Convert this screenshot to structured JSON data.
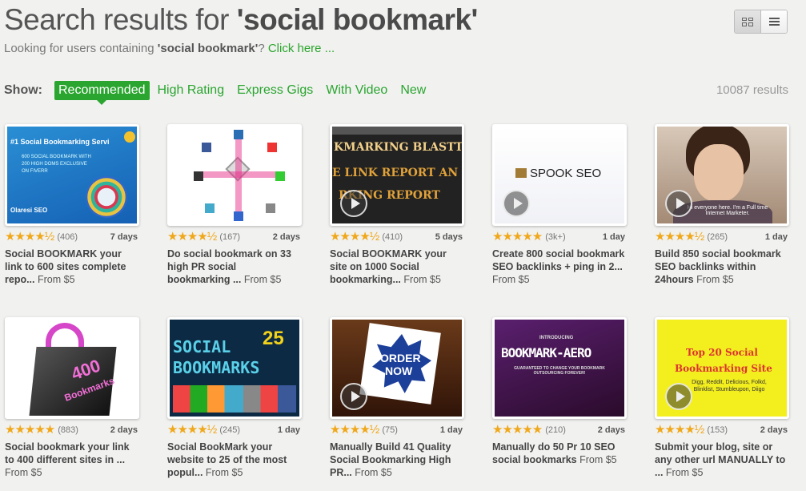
{
  "header": {
    "title_prefix": "Search results for ",
    "query": "'social bookmark'",
    "sub_prefix": "Looking for users containing ",
    "sub_query": "'social bookmark'",
    "sub_suffix": "? ",
    "sub_link": "Click here ..."
  },
  "view_toggle": {
    "grid_icon": "grid-icon",
    "list_icon": "list-icon"
  },
  "filters": {
    "show_label": "Show:",
    "active": "Recommended",
    "links": [
      "High Rating",
      "Express Gigs",
      "With Video",
      "New"
    ]
  },
  "results_count": "10087 results",
  "colors": {
    "accent": "#2aa52f",
    "stars": "#f0a81a"
  },
  "gigs": [
    {
      "stars": "★★★★½",
      "reviews": "(406)",
      "days": "7 days",
      "title": "Social BOOKMARK your link to 600 sites complete repo...",
      "price": "From $5",
      "video": false,
      "art": {
        "line1": "#1 Social Bookmarking Servi",
        "line2": "600 SOCIAL BOOKMARK WITH 200 HIGH DOMS EXCLUSIVE ON FIVERR",
        "brand": "Olaresi SEO"
      }
    },
    {
      "stars": "★★★★½",
      "reviews": "(167)",
      "days": "2 days",
      "title": "Do social bookmark on 33 high PR social bookmarking ...",
      "price": "From $5",
      "video": false,
      "art": {}
    },
    {
      "stars": "★★★★½",
      "reviews": "(410)",
      "days": "5 days",
      "title": "Social BOOKMARK your site on 1000 Social bookmarking...",
      "price": "From $5",
      "video": true,
      "art": {
        "line1": "KMARKING BLASTTI",
        "line2": "E LINK REPORT AN",
        "line3": "RKING REPORT"
      }
    },
    {
      "stars": "★★★★★",
      "reviews": "(3k+)",
      "days": "1 day",
      "title": "Create 800 social bookmark SEO backlinks + ping in 2...",
      "price": "From $5",
      "video": true,
      "art": {
        "line1": "SPOOK SEO"
      }
    },
    {
      "stars": "★★★★½",
      "reviews": "(265)",
      "days": "1 day",
      "title": "Build 850 social bookmark SEO backlinks within 24hours",
      "price": "From $5",
      "video": true,
      "art": {
        "line1": "Hi everyone here. I'm a Full time Internet Marketer."
      }
    },
    {
      "stars": "★★★★★",
      "reviews": "(883)",
      "days": "2 days",
      "title": "Social bookmark your link to 400 different sites in ...",
      "price": "From $5",
      "video": false,
      "art": {
        "line1": "400",
        "line2": "Bookmarks"
      }
    },
    {
      "stars": "★★★★½",
      "reviews": "(245)",
      "days": "1 day",
      "title": "Social BookMark your website to 25 of the most popul...",
      "price": "From $5",
      "video": false,
      "art": {
        "line1": "SOCIAL",
        "line2": "BOOKMARKS",
        "num": "25"
      }
    },
    {
      "stars": "★★★★½",
      "reviews": "(75)",
      "days": "1 day",
      "title": "Manually Build 41 Quality Social Bookmarking High PR...",
      "price": "From $5",
      "video": true,
      "art": {
        "line1": "ORDER",
        "line2": "NOW"
      }
    },
    {
      "stars": "★★★★★",
      "reviews": "(210)",
      "days": "2 days",
      "title": "Manually do 50 Pr 10 SEO social bookmarks",
      "price": "From $5",
      "video": false,
      "art": {
        "line0": "INTRODUCING",
        "line1": "BOOKMARK-AERO",
        "line2": "GUARANTEED TO CHANGE YOUR BOOKMARK OUTSOURCING FOREVER!"
      }
    },
    {
      "stars": "★★★★½",
      "reviews": "(153)",
      "days": "2 days",
      "title": "Submit your blog, site or any other url MANUALLY to ...",
      "price": "From $5",
      "video": true,
      "art": {
        "line1": "Top 20 Social",
        "line2": "Bookmarking Site",
        "line3": "Digg, Reddit, Delicious, Folkd, Blinklist, Stumbleupon, Diigo"
      }
    }
  ]
}
